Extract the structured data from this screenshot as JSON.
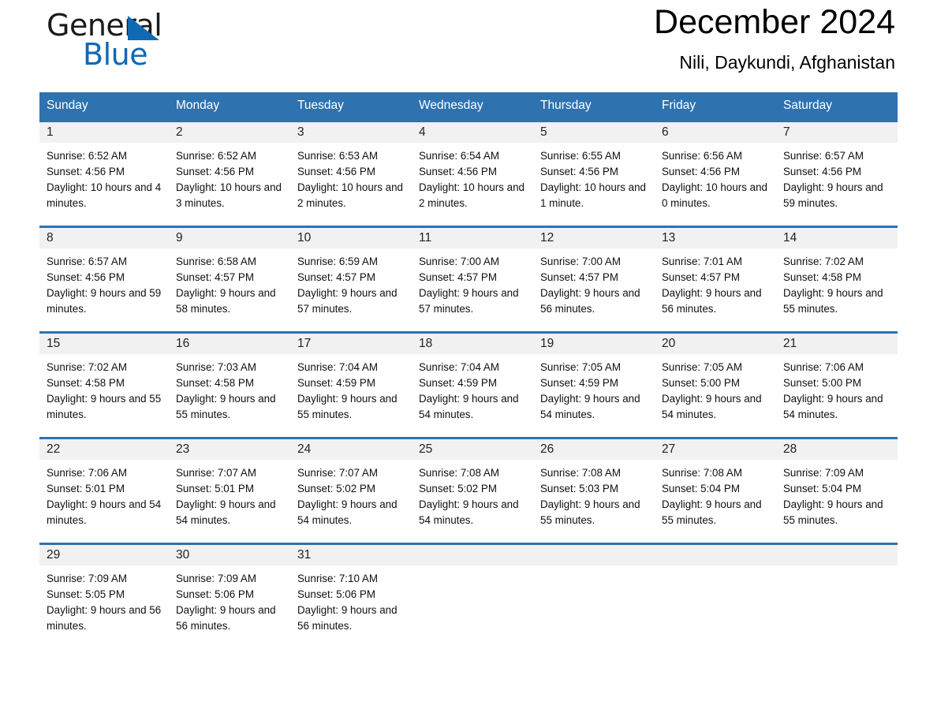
{
  "brand": {
    "name_part1": "General",
    "name_part2": "Blue",
    "triangle_icon": "triangle-icon",
    "accent_color": "#1069b4"
  },
  "header": {
    "title": "December 2024",
    "subtitle": "Nili, Daykundi, Afghanistan"
  },
  "calendar": {
    "header_color": "#2e72b0",
    "daynum_band_color": "#f1f1f1",
    "weekdays": [
      "Sunday",
      "Monday",
      "Tuesday",
      "Wednesday",
      "Thursday",
      "Friday",
      "Saturday"
    ],
    "weeks": [
      [
        {
          "day": "1",
          "sunrise": "Sunrise: 6:52 AM",
          "sunset": "Sunset: 4:56 PM",
          "daylight": "Daylight: 10 hours and 4 minutes."
        },
        {
          "day": "2",
          "sunrise": "Sunrise: 6:52 AM",
          "sunset": "Sunset: 4:56 PM",
          "daylight": "Daylight: 10 hours and 3 minutes."
        },
        {
          "day": "3",
          "sunrise": "Sunrise: 6:53 AM",
          "sunset": "Sunset: 4:56 PM",
          "daylight": "Daylight: 10 hours and 2 minutes."
        },
        {
          "day": "4",
          "sunrise": "Sunrise: 6:54 AM",
          "sunset": "Sunset: 4:56 PM",
          "daylight": "Daylight: 10 hours and 2 minutes."
        },
        {
          "day": "5",
          "sunrise": "Sunrise: 6:55 AM",
          "sunset": "Sunset: 4:56 PM",
          "daylight": "Daylight: 10 hours and 1 minute."
        },
        {
          "day": "6",
          "sunrise": "Sunrise: 6:56 AM",
          "sunset": "Sunset: 4:56 PM",
          "daylight": "Daylight: 10 hours and 0 minutes."
        },
        {
          "day": "7",
          "sunrise": "Sunrise: 6:57 AM",
          "sunset": "Sunset: 4:56 PM",
          "daylight": "Daylight: 9 hours and 59 minutes."
        }
      ],
      [
        {
          "day": "8",
          "sunrise": "Sunrise: 6:57 AM",
          "sunset": "Sunset: 4:56 PM",
          "daylight": "Daylight: 9 hours and 59 minutes."
        },
        {
          "day": "9",
          "sunrise": "Sunrise: 6:58 AM",
          "sunset": "Sunset: 4:57 PM",
          "daylight": "Daylight: 9 hours and 58 minutes."
        },
        {
          "day": "10",
          "sunrise": "Sunrise: 6:59 AM",
          "sunset": "Sunset: 4:57 PM",
          "daylight": "Daylight: 9 hours and 57 minutes."
        },
        {
          "day": "11",
          "sunrise": "Sunrise: 7:00 AM",
          "sunset": "Sunset: 4:57 PM",
          "daylight": "Daylight: 9 hours and 57 minutes."
        },
        {
          "day": "12",
          "sunrise": "Sunrise: 7:00 AM",
          "sunset": "Sunset: 4:57 PM",
          "daylight": "Daylight: 9 hours and 56 minutes."
        },
        {
          "day": "13",
          "sunrise": "Sunrise: 7:01 AM",
          "sunset": "Sunset: 4:57 PM",
          "daylight": "Daylight: 9 hours and 56 minutes."
        },
        {
          "day": "14",
          "sunrise": "Sunrise: 7:02 AM",
          "sunset": "Sunset: 4:58 PM",
          "daylight": "Daylight: 9 hours and 55 minutes."
        }
      ],
      [
        {
          "day": "15",
          "sunrise": "Sunrise: 7:02 AM",
          "sunset": "Sunset: 4:58 PM",
          "daylight": "Daylight: 9 hours and 55 minutes."
        },
        {
          "day": "16",
          "sunrise": "Sunrise: 7:03 AM",
          "sunset": "Sunset: 4:58 PM",
          "daylight": "Daylight: 9 hours and 55 minutes."
        },
        {
          "day": "17",
          "sunrise": "Sunrise: 7:04 AM",
          "sunset": "Sunset: 4:59 PM",
          "daylight": "Daylight: 9 hours and 55 minutes."
        },
        {
          "day": "18",
          "sunrise": "Sunrise: 7:04 AM",
          "sunset": "Sunset: 4:59 PM",
          "daylight": "Daylight: 9 hours and 54 minutes."
        },
        {
          "day": "19",
          "sunrise": "Sunrise: 7:05 AM",
          "sunset": "Sunset: 4:59 PM",
          "daylight": "Daylight: 9 hours and 54 minutes."
        },
        {
          "day": "20",
          "sunrise": "Sunrise: 7:05 AM",
          "sunset": "Sunset: 5:00 PM",
          "daylight": "Daylight: 9 hours and 54 minutes."
        },
        {
          "day": "21",
          "sunrise": "Sunrise: 7:06 AM",
          "sunset": "Sunset: 5:00 PM",
          "daylight": "Daylight: 9 hours and 54 minutes."
        }
      ],
      [
        {
          "day": "22",
          "sunrise": "Sunrise: 7:06 AM",
          "sunset": "Sunset: 5:01 PM",
          "daylight": "Daylight: 9 hours and 54 minutes."
        },
        {
          "day": "23",
          "sunrise": "Sunrise: 7:07 AM",
          "sunset": "Sunset: 5:01 PM",
          "daylight": "Daylight: 9 hours and 54 minutes."
        },
        {
          "day": "24",
          "sunrise": "Sunrise: 7:07 AM",
          "sunset": "Sunset: 5:02 PM",
          "daylight": "Daylight: 9 hours and 54 minutes."
        },
        {
          "day": "25",
          "sunrise": "Sunrise: 7:08 AM",
          "sunset": "Sunset: 5:02 PM",
          "daylight": "Daylight: 9 hours and 54 minutes."
        },
        {
          "day": "26",
          "sunrise": "Sunrise: 7:08 AM",
          "sunset": "Sunset: 5:03 PM",
          "daylight": "Daylight: 9 hours and 55 minutes."
        },
        {
          "day": "27",
          "sunrise": "Sunrise: 7:08 AM",
          "sunset": "Sunset: 5:04 PM",
          "daylight": "Daylight: 9 hours and 55 minutes."
        },
        {
          "day": "28",
          "sunrise": "Sunrise: 7:09 AM",
          "sunset": "Sunset: 5:04 PM",
          "daylight": "Daylight: 9 hours and 55 minutes."
        }
      ],
      [
        {
          "day": "29",
          "sunrise": "Sunrise: 7:09 AM",
          "sunset": "Sunset: 5:05 PM",
          "daylight": "Daylight: 9 hours and 56 minutes."
        },
        {
          "day": "30",
          "sunrise": "Sunrise: 7:09 AM",
          "sunset": "Sunset: 5:06 PM",
          "daylight": "Daylight: 9 hours and 56 minutes."
        },
        {
          "day": "31",
          "sunrise": "Sunrise: 7:10 AM",
          "sunset": "Sunset: 5:06 PM",
          "daylight": "Daylight: 9 hours and 56 minutes."
        },
        {
          "day": "",
          "sunrise": "",
          "sunset": "",
          "daylight": ""
        },
        {
          "day": "",
          "sunrise": "",
          "sunset": "",
          "daylight": ""
        },
        {
          "day": "",
          "sunrise": "",
          "sunset": "",
          "daylight": ""
        },
        {
          "day": "",
          "sunrise": "",
          "sunset": "",
          "daylight": ""
        }
      ]
    ]
  }
}
